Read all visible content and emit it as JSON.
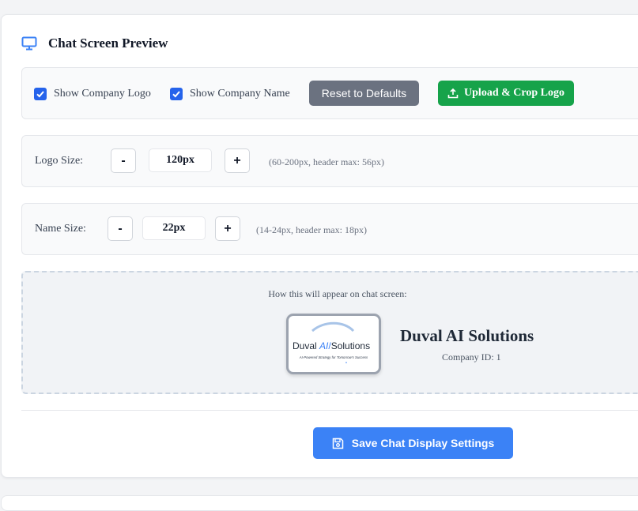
{
  "section": {
    "title": "Chat Screen Preview",
    "icon": "monitor-icon"
  },
  "toolbar": {
    "show_logo": {
      "label": "Show Company Logo",
      "checked": true
    },
    "show_name": {
      "label": "Show Company Name",
      "checked": true
    },
    "reset_label": "Reset to Defaults",
    "upload_label": "Upload & Crop Logo",
    "upload_icon": "upload-icon"
  },
  "logo_size": {
    "label": "Logo Size:",
    "minus": "-",
    "value": "120px",
    "plus": "+",
    "hint": "(60-200px, header max: 56px)"
  },
  "name_size": {
    "label": "Name Size:",
    "minus": "-",
    "value": "22px",
    "plus": "+",
    "hint": "(14-24px, header max: 18px)"
  },
  "preview": {
    "caption": "How this will appear on chat screen:",
    "logo": {
      "brand_left": "Duval ",
      "brand_ai": "AI",
      "brand_slash": "/",
      "brand_right": "Solutions",
      "tagline": "AI-Powered Strategy for Tomorrow's Success"
    },
    "company_name": "Duval AI Solutions",
    "company_id": "Company ID: 1"
  },
  "save_label": "Save Chat Display Settings",
  "colors": {
    "primary": "#3b82f6",
    "success": "#16a34a",
    "secondary": "#6b7280",
    "checkbox": "#2563eb"
  }
}
